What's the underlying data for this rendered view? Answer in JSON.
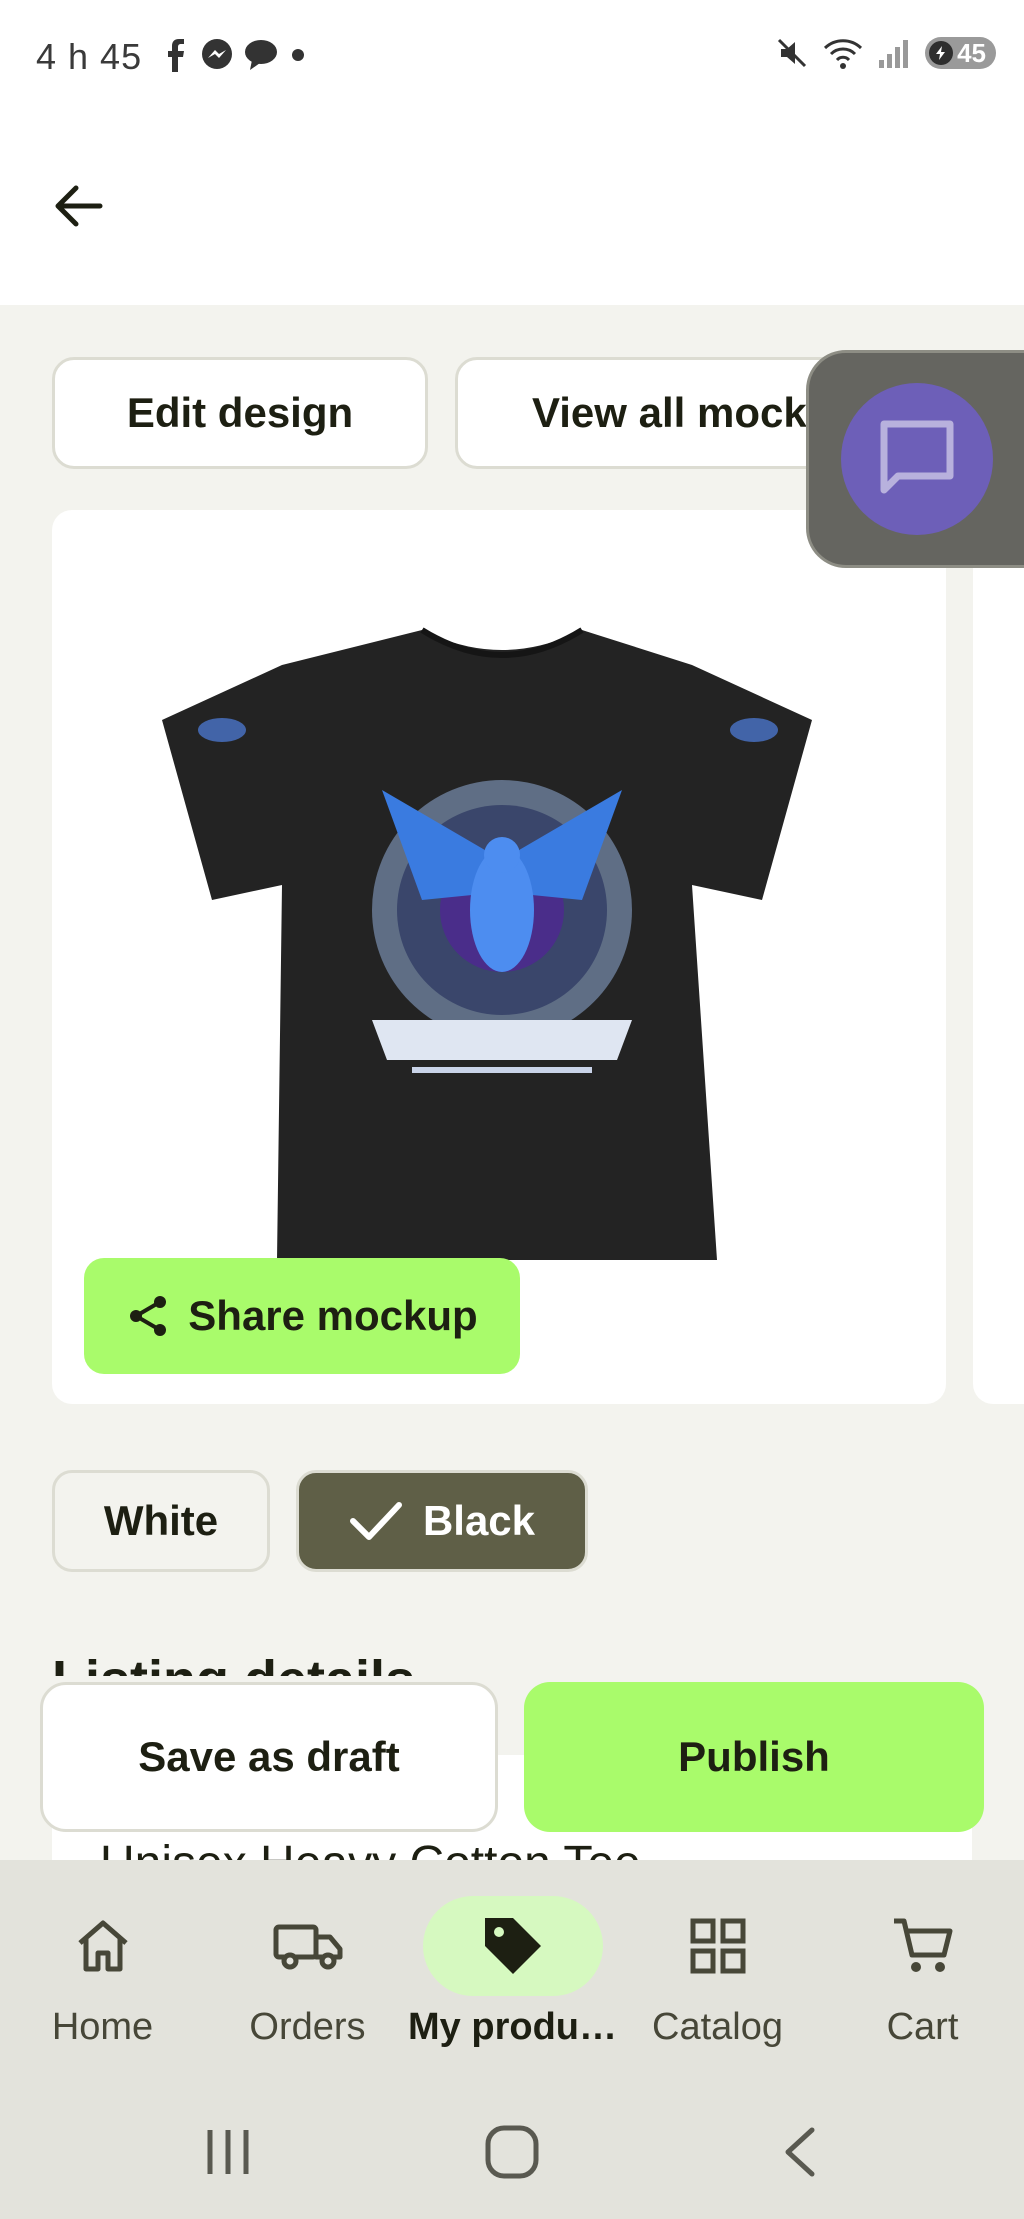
{
  "status_bar": {
    "time": "4 h 45",
    "battery": "45",
    "icons_left": [
      "facebook-icon",
      "messenger-icon",
      "chat-icon",
      "dot-icon"
    ],
    "icons_right": [
      "mute-icon",
      "wifi-icon",
      "signal-icon",
      "battery-icon"
    ]
  },
  "toolbar": {
    "edit_design_label": "Edit design",
    "view_mockups_label": "View all mock"
  },
  "mockup": {
    "share_label": "Share mockup",
    "color_accent": "#a9fb6b"
  },
  "colors": {
    "options": [
      {
        "label": "White",
        "selected": false
      },
      {
        "label": "Black",
        "selected": true
      }
    ]
  },
  "listing": {
    "heading": "Listing details",
    "title_peek": "Unisex Heavy Cotton Tee"
  },
  "actions": {
    "save_draft_label": "Save as draft",
    "publish_label": "Publish"
  },
  "nav": {
    "items": [
      {
        "label": "Home",
        "icon": "home-icon",
        "active": false
      },
      {
        "label": "Orders",
        "icon": "truck-icon",
        "active": false
      },
      {
        "label": "My produ…",
        "icon": "tag-icon",
        "active": true
      },
      {
        "label": "Catalog",
        "icon": "grid-icon",
        "active": false
      },
      {
        "label": "Cart",
        "icon": "cart-icon",
        "active": false
      }
    ]
  }
}
